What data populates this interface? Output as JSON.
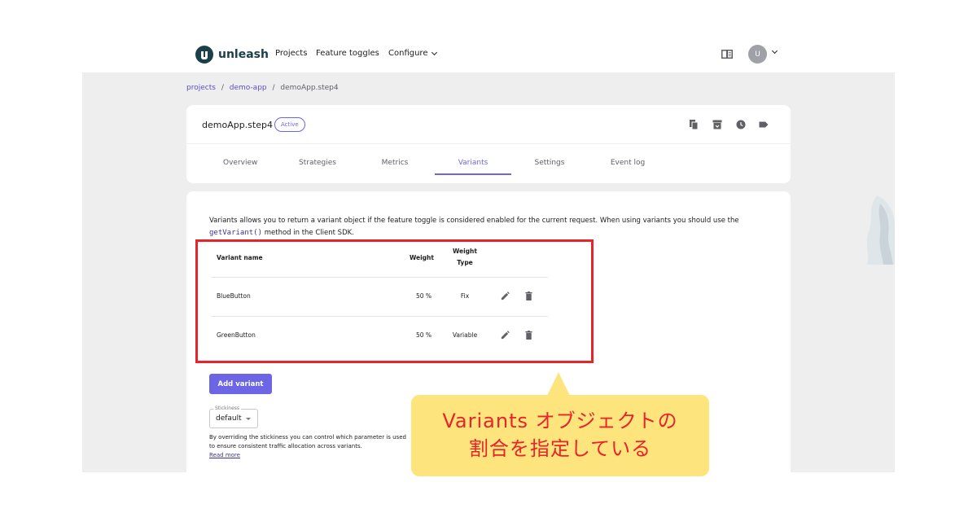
{
  "topbar": {
    "logo_text": "unleash",
    "nav": [
      "Projects",
      "Feature toggles",
      "Configure"
    ],
    "avatar_initial": "U"
  },
  "breadcrumb": {
    "items": [
      "projects",
      "demo-app",
      "demoApp.step4"
    ],
    "separator": "/"
  },
  "toggle": {
    "name": "demoApp.step4",
    "status": "Active"
  },
  "tabs": [
    "Overview",
    "Strategies",
    "Metrics",
    "Variants",
    "Settings",
    "Event log"
  ],
  "active_tab": "Variants",
  "variants": {
    "description_before": "Variants allows you to return a variant object if the feature toggle is considered enabled for the current request. When using variants you should use the",
    "description_code": "getVariant()",
    "description_after": " method in the Client SDK.",
    "headers": {
      "name": "Variant name",
      "weight": "Weight",
      "weight_type_1": "Weight",
      "weight_type_2": "Type"
    },
    "rows": [
      {
        "name": "BlueButton",
        "weight": "50 %",
        "type": "Fix"
      },
      {
        "name": "GreenButton",
        "weight": "50 %",
        "type": "Variable"
      }
    ],
    "add_label": "Add variant"
  },
  "stickiness": {
    "label": "Stickiness",
    "value": "default",
    "help": "By overriding the stickiness you can control which parameter is used to ensure consistent traffic allocation across variants.",
    "read_more": "Read more"
  },
  "callout": {
    "line1": "Variants オブジェクトの",
    "line2": "割合を指定している"
  },
  "colors": {
    "primary": "#6c65e5",
    "highlight": "#e8232a",
    "callout_bg": "#fde47d",
    "logo": "#1a4049"
  }
}
